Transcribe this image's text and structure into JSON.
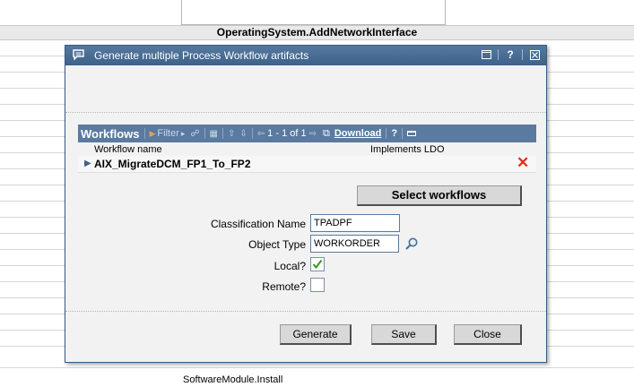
{
  "background": {
    "header_title": "OperatingSystem.AddNetworkInterface",
    "footer_item": "SoftwareModule.Install"
  },
  "dialog": {
    "title": "Generate multiple Process Workflow artifacts",
    "title_help": "?"
  },
  "workflows": {
    "title": "Workflows",
    "filter_label": "Filter",
    "pagination": "1 - 1 of 1",
    "download_label": "Download",
    "help": "?",
    "columns": [
      "Workflow name",
      "Implements LDO"
    ],
    "rows": [
      {
        "name": "AIX_MigrateDCM_FP1_To_FP2",
        "implements_ldo": ""
      }
    ]
  },
  "select_button": "Select workflows",
  "form": {
    "classification_label": "Classification Name",
    "classification_value": "TPADPF",
    "object_type_label": "Object Type",
    "object_type_value": "WORKORDER",
    "local_label": "Local?",
    "local_checked": true,
    "remote_label": "Remote?",
    "remote_checked": false
  },
  "buttons": {
    "generate": "Generate",
    "save": "Save",
    "close": "Close"
  },
  "colors": {
    "title_bar": "#4a6e95",
    "panel_header": "#5a7aa0",
    "delete_red": "#e03020",
    "check_green": "#3a9a1a"
  }
}
